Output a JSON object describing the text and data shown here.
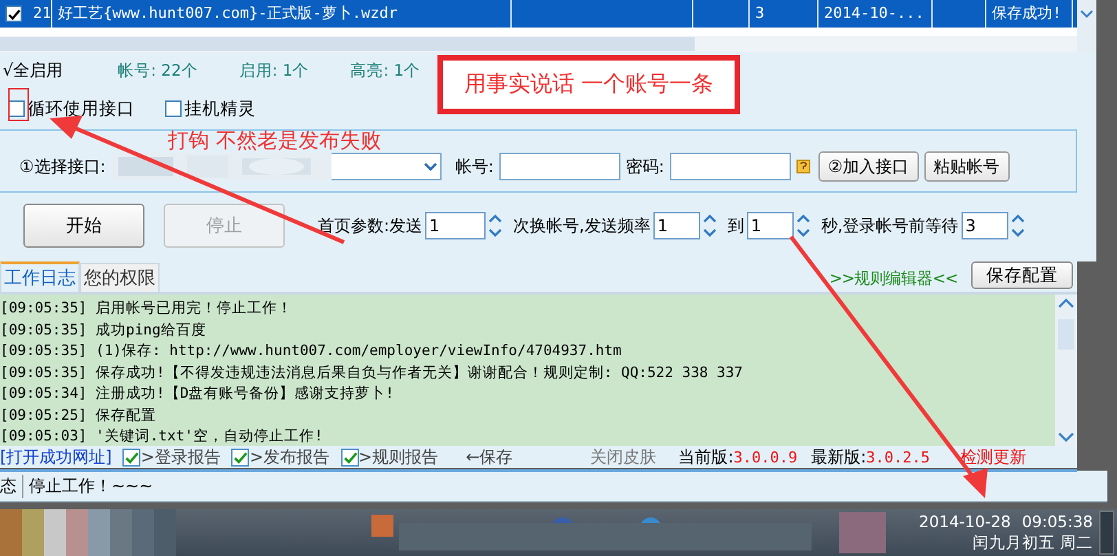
{
  "table": {
    "rows": [
      {
        "checked": true,
        "selected": true,
        "cells": [
          "21",
          "好工艺{www.hunt007.com}-正式版-萝卜.wzdr",
          null,
          null,
          "3",
          "2014-10-...",
          null,
          "保存成功!"
        ]
      }
    ]
  },
  "summary": {
    "enable_all": "√全启用",
    "stats": [
      {
        "label": "帐号: 22个"
      },
      {
        "label": "启用: 1个"
      },
      {
        "label": "高亮: 1个"
      }
    ]
  },
  "options": [
    {
      "label": "循环使用接口",
      "checked": false
    },
    {
      "label": "挂机精灵",
      "checked": false
    }
  ],
  "interface_panel": {
    "select_label": "①选择接口:",
    "account_label": "帐号:",
    "password_label": "密码:",
    "buttons": [
      "②加入接口",
      "粘贴帐号"
    ]
  },
  "controls": {
    "start": {
      "label": "开始",
      "disabled": false
    },
    "stop": {
      "label": "停止",
      "disabled": true
    },
    "params": [
      {
        "label": "首页参数:发送",
        "value": "1"
      },
      {
        "label": "次换帐号,发送频率",
        "value": "1"
      },
      {
        "label": "到",
        "value": "1"
      },
      {
        "label": "秒,登录帐号前等待",
        "value": "3"
      }
    ]
  },
  "tabs": [
    {
      "label": "工作日志",
      "selected": true
    },
    {
      "label": "您的权限",
      "selected": false
    }
  ],
  "rule_editor_link": ">>规则编辑器<<",
  "save_config_button": "保存配置",
  "log": [
    "[09:05:35] 启用帐号已用完！停止工作！",
    "[09:05:35] 成功ping给百度",
    "[09:05:35] (1)保存: http://www.hunt007.com/employer/viewInfo/4704937.htm",
    "[09:05:35] 保存成功!【不得发违规违法消息后果自负与作者无关】谢谢配合！规则定制: QQ:522 338 337",
    "[09:05:34] 注册成功!【D盘有账号备份】感谢支持萝卜!",
    "[09:05:25] 保存配置",
    "[09:05:03] '关键词.txt'空，自动停止工作!"
  ],
  "footer": {
    "open_link": "[打开成功网址]",
    "reports": [
      {
        "label": ">登录报告",
        "checked": true
      },
      {
        "label": ">发布报告",
        "checked": true
      },
      {
        "label": ">规则报告",
        "checked": true
      }
    ],
    "save": "←保存",
    "close_skin": "关闭皮肤",
    "current_label": "当前版:",
    "current_version": "3.0.0.9",
    "latest_label": "最新版:",
    "latest_version": "3.0.2.5",
    "check_update": "检测更新"
  },
  "status_bar": {
    "label": "态",
    "message": "停止工作！~~~"
  },
  "taskbar": {
    "date": "2014-10-28",
    "time": "09:05:38",
    "lunar": "闰九月初五 周二"
  },
  "annotations": [
    {
      "kind": "callout",
      "text": "用事实说话 一个账号一条"
    },
    {
      "kind": "highlight"
    },
    {
      "kind": "note",
      "text": "打钩 不然老是发布失败"
    },
    {
      "kind": "arrow"
    },
    {
      "kind": "arrow"
    }
  ]
}
